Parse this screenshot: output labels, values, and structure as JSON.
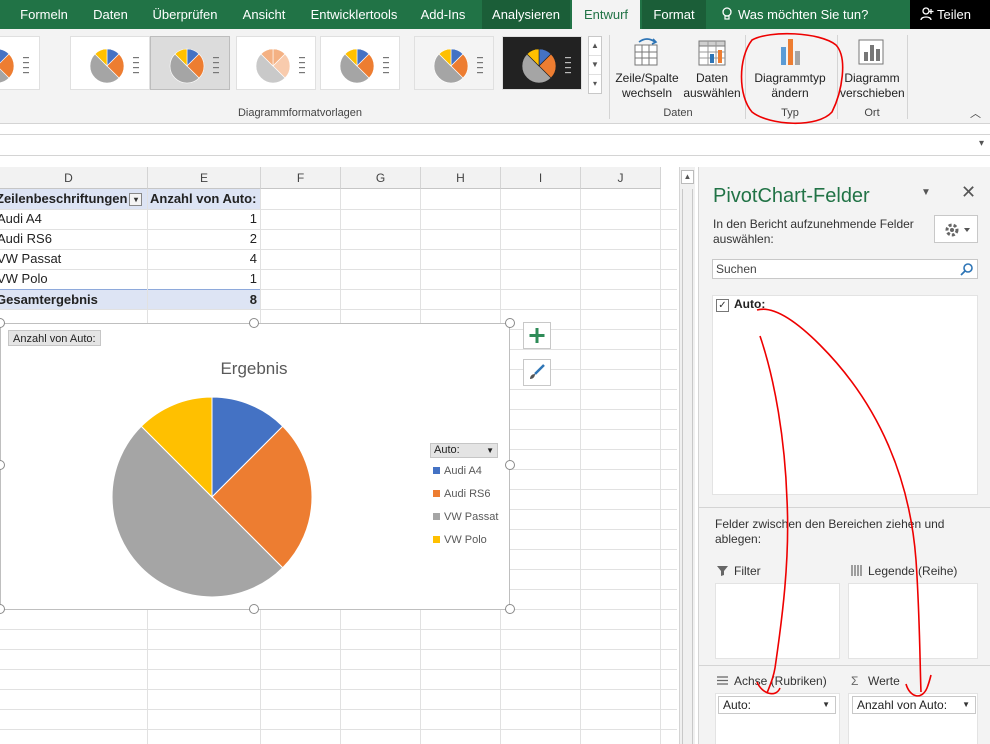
{
  "ribbon_tabs": [
    {
      "label": "Formeln"
    },
    {
      "label": "Daten"
    },
    {
      "label": "Überprüfen"
    },
    {
      "label": "Ansicht"
    },
    {
      "label": "Entwicklertools"
    },
    {
      "label": "Add-Ins"
    },
    {
      "label": "Analysieren"
    },
    {
      "label": "Entwurf"
    },
    {
      "label": "Format"
    }
  ],
  "active_tab": "Entwurf",
  "tell_me": "Was möchten Sie tun?",
  "share": "Teilen",
  "ribbon": {
    "style_gallery_label": "Diagrammformatvorlagen",
    "switch_row_col": "Zeile/Spalte wechseln",
    "select_data": "Daten auswählen",
    "data_group": "Daten",
    "change_type": "Diagrammtyp ändern",
    "type_group": "Typ",
    "move_chart": "Diagramm verschieben",
    "location_group": "Ort"
  },
  "sheet": {
    "columns": [
      "D",
      "E",
      "F",
      "G",
      "H",
      "I",
      "J"
    ],
    "pivot_header_label": "Zeilenbeschriftungen",
    "pivot_header_value": "Anzahl von Auto:",
    "rows": [
      {
        "label": "Audi A4",
        "value": "1"
      },
      {
        "label": "Audi RS6",
        "value": "2"
      },
      {
        "label": "VW Passat",
        "value": "4"
      },
      {
        "label": "VW Polo",
        "value": "1"
      }
    ],
    "total_label": "Gesamtergebnis",
    "total_value": "8"
  },
  "chart": {
    "value_field_button": "Anzahl von Auto:",
    "legend_field_button": "Auto:"
  },
  "chart_data": {
    "type": "pie",
    "title": "Ergebnis",
    "categories": [
      "Audi A4",
      "Audi RS6",
      "VW Passat",
      "VW Polo"
    ],
    "values": [
      1,
      2,
      4,
      1
    ],
    "colors": [
      "#4472c4",
      "#ed7d31",
      "#a5a5a5",
      "#ffc000"
    ],
    "legend_position": "right"
  },
  "pane": {
    "title": "PivotChart-Felder",
    "subtitle": "In den Bericht aufzunehmende Felder auswählen:",
    "search_placeholder": "Suchen",
    "field": "Auto:",
    "drag_hint": "Felder zwischen den Bereichen ziehen und ablegen:",
    "filter": "Filter",
    "legend": "Legende (Reihe)",
    "axis": "Achse (Rubriken)",
    "values": "Werte",
    "axis_chip": "Auto:",
    "values_chip": "Anzahl von Auto:"
  }
}
